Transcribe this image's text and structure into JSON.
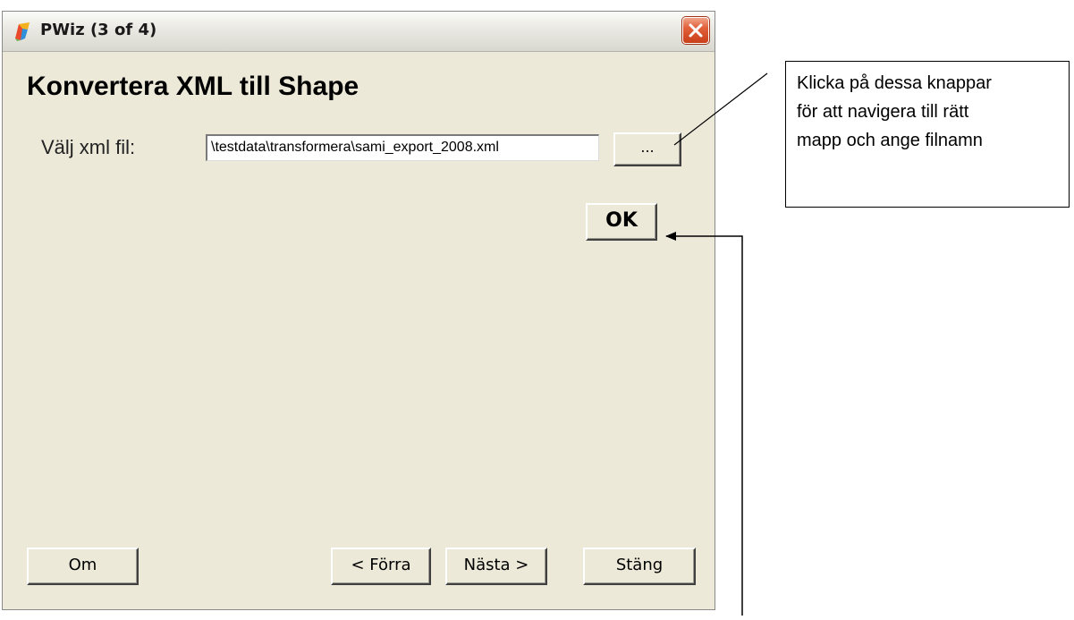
{
  "window": {
    "title": "PWiz (3 of 4)",
    "close_label": "Close"
  },
  "content": {
    "heading": "Konvertera XML till Shape",
    "xml_label": "Välj xml fil:",
    "xml_path_value": "\\testdata\\transformera\\sami_export_2008.xml",
    "browse_label": "...",
    "ok_label": "OK"
  },
  "footer": {
    "about_label": "Om",
    "prev_label": "< Förra",
    "next_label": "Nästa >",
    "close_label": "Stäng"
  },
  "callout": {
    "lines": [
      "Klicka på dessa knappar",
      "för att navigera till rätt",
      "mapp och ange filnamn"
    ]
  },
  "icons": {
    "app": "pwiz-app-icon",
    "close": "close-x-icon"
  },
  "colors": {
    "window_bg": "#ece9d8",
    "close_button": "#e2603b",
    "annotation_stroke": "#000000"
  }
}
